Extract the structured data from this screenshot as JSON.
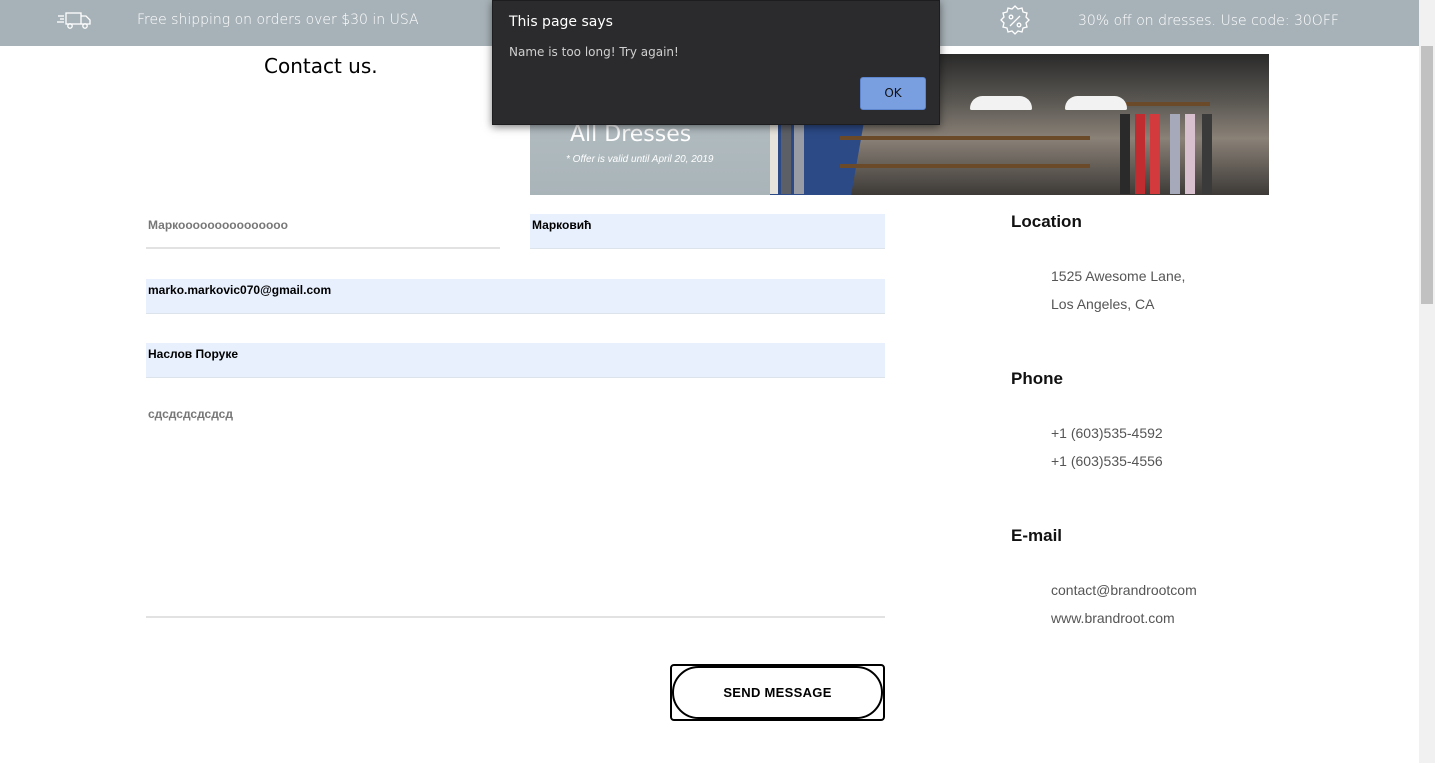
{
  "topbar": {
    "shipping_icon": "delivery-truck-icon",
    "shipping_text": "Free shipping on orders over $30 in USA",
    "discount_icon": "percent-badge-icon",
    "discount_text": "30% off on dresses. Use code: 30OFF"
  },
  "contact": {
    "title": "Contact us."
  },
  "banner": {
    "headline": "All Dresses",
    "note": "* Offer is valid until April 20, 2019"
  },
  "form": {
    "first_name": "Маркооооооооооооооо",
    "last_name": "Марковић",
    "email": "marko.markovic070@gmail.com",
    "subject": "Наслов Поруке",
    "message": "сдсдсдсдсдсд",
    "send_label": "SEND MESSAGE"
  },
  "info": {
    "location_heading": "Location",
    "address_line1": "1525 Awesome Lane,",
    "address_line2": "Los Angeles, CA",
    "phone_heading": "Phone",
    "phone1": "+1 (603)535-4592",
    "phone2": "+1 (603)535-4556",
    "email_heading": "E-mail",
    "email": "contact@brandrootcom",
    "website": "www.brandroot.com"
  },
  "dialog": {
    "title": "This page says",
    "message": "Name is too long! Try again!",
    "ok_label": "OK"
  },
  "colors": {
    "topbar": "#a7b2b8",
    "autofill": "#e8f0fe",
    "dialog_bg": "#2b2b2d",
    "ok_button": "#7a9fe0"
  }
}
